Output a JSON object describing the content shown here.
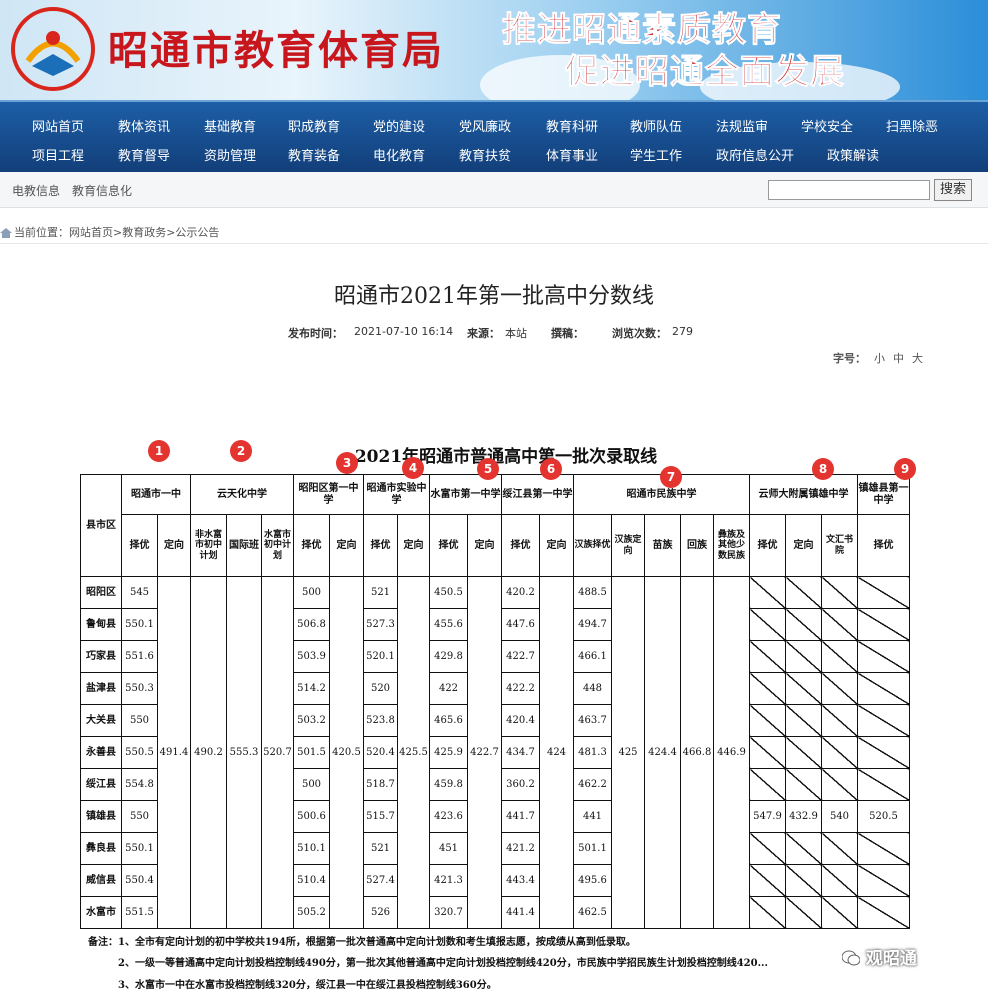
{
  "header": {
    "site_title": "昭通市教育体育局",
    "slogan_line1": "推进昭通素质教育",
    "slogan_line2": "促进昭通全面发展"
  },
  "nav": {
    "row1": [
      "网站首页",
      "教体资讯",
      "基础教育",
      "职成教育",
      "党的建设",
      "党风廉政",
      "教育科研",
      "教师队伍",
      "法规监审",
      "学校安全",
      "扫黑除恶"
    ],
    "row2": [
      "项目工程",
      "教育督导",
      "资助管理",
      "教育装备",
      "电化教育",
      "教育扶贫",
      "体育事业",
      "学生工作",
      "政府信息公开",
      "政策解读"
    ]
  },
  "subnav": {
    "link1": "电教信息",
    "link2": "教育信息化"
  },
  "search": {
    "value": "",
    "button": "搜索"
  },
  "breadcrumb": {
    "text": "当前位置：网站首页>教育政务>公示公告"
  },
  "article": {
    "title": "昭通市2021年第一批高中分数线",
    "publish_label": "发布时间：",
    "publish_time": "2021-07-10 16:14",
    "source_label": "来源：",
    "source": "本站",
    "author_label": "撰稿：",
    "views_label": "浏览次数：",
    "views": "279",
    "fontsize_label": "字号：",
    "fontsize_small": "小",
    "fontsize_medium": "中",
    "fontsize_large": "大"
  },
  "doc": {
    "title": "2021年昭通市普通高中第一批次录取线",
    "badges": [
      "1",
      "2",
      "3",
      "4",
      "5",
      "6",
      "7",
      "8",
      "9"
    ],
    "table": {
      "county_header": "县市区",
      "schools": [
        "昭通市一中",
        "云天化中学",
        "昭阳区第一中学",
        "昭通市实验中学",
        "水富市第一中学",
        "绥江县第一中学",
        "昭通市民族中学",
        "云师大附属镇雄中学",
        "镇雄县第一中学"
      ],
      "subheaders": [
        "择优",
        "定向",
        "非水富市初中计划",
        "国际班",
        "水富市初中计划",
        "择优",
        "定向",
        "择优",
        "定向",
        "择优",
        "定向",
        "择优",
        "定向",
        "汉族择优",
        "汉族定向",
        "苗族",
        "回族",
        "彝族及其他少数民族",
        "择优",
        "定向",
        "文汇书院",
        "择优"
      ],
      "merged": [
        "491.4",
        "490.2",
        "555.3",
        "520.7",
        "420.5",
        "425.5",
        "422.7",
        "424",
        "425",
        "424.4",
        "466.8",
        "446.9"
      ],
      "rows": [
        {
          "county": "昭阳区",
          "v": [
            "545",
            "500",
            "521",
            "450.5",
            "420.2",
            "488.5"
          ]
        },
        {
          "county": "鲁甸县",
          "v": [
            "550.1",
            "506.8",
            "527.3",
            "455.6",
            "447.6",
            "494.7"
          ]
        },
        {
          "county": "巧家县",
          "v": [
            "551.6",
            "503.9",
            "520.1",
            "429.8",
            "422.7",
            "466.1"
          ]
        },
        {
          "county": "盐津县",
          "v": [
            "550.3",
            "514.2",
            "520",
            "422",
            "422.2",
            "448"
          ]
        },
        {
          "county": "大关县",
          "v": [
            "550",
            "503.2",
            "523.8",
            "465.6",
            "420.4",
            "463.7"
          ]
        },
        {
          "county": "永善县",
          "v": [
            "550.5",
            "501.5",
            "520.4",
            "425.9",
            "434.7",
            "481.3"
          ]
        },
        {
          "county": "绥江县",
          "v": [
            "554.8",
            "500",
            "518.7",
            "459.8",
            "360.2",
            "462.2"
          ]
        },
        {
          "county": "镇雄县",
          "v": [
            "550",
            "500.6",
            "515.7",
            "423.6",
            "441.7",
            "441"
          ]
        },
        {
          "county": "彝良县",
          "v": [
            "550.1",
            "510.1",
            "521",
            "451",
            "421.2",
            "501.1"
          ]
        },
        {
          "county": "威信县",
          "v": [
            "550.4",
            "510.4",
            "527.4",
            "421.3",
            "443.4",
            "495.6"
          ]
        },
        {
          "county": "水富市",
          "v": [
            "551.5",
            "505.2",
            "526",
            "320.7",
            "441.4",
            "462.5"
          ]
        }
      ],
      "zhenxiong_extra": [
        "547.9",
        "432.9",
        "540",
        "520.5"
      ]
    },
    "notes": [
      "备注：1、全市有定向计划的初中学校共194所，根据第一批次普通高中定向计划数和考生填报志愿，按成绩从高到低录取。",
      "2、一级一等普通高中定向计划投档控制线490分，第一批次其他普通高中定向计划投档控制线420分，市民族中学招民族生计划投档控制线420...",
      "3、水富市一中在水富市投档控制线320分，绥江县一中在绥江县投档控制线360分。"
    ],
    "watermark": "观昭通"
  },
  "colors": {
    "nav_bg": "#1d5ea6",
    "title_red": "#c8161d",
    "badge_red": "#e3342f"
  }
}
